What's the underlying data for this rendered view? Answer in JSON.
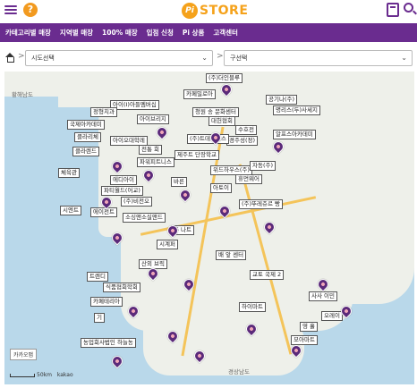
{
  "header": {
    "logo_badge": "Pi",
    "logo_text": "STORE",
    "help_label": "?",
    "icons": [
      "hamburger-icon",
      "help-icon",
      "calculator-icon",
      "search-icon"
    ]
  },
  "nav": {
    "items": [
      "카테고리별 매장",
      "지역별 매장",
      "100% 매장",
      "입점 신청",
      "Pi 상품",
      "고객센터"
    ]
  },
  "filters": {
    "separator": ">",
    "province_select": "시도선택",
    "district_select": "구선택"
  },
  "map": {
    "regions": [
      "황해남도",
      "경상남도"
    ],
    "labels": [
      "(주)더인블루",
      "카페밀로아",
      "아이(I)아들멤버십",
      "공기나(주)",
      "명리스(두)사세지",
      "대헌협회",
      "수호전",
      "경주성(정)",
      "제주트 단장학교",
      "정형치과",
      "국제아카데미",
      "(주)트데이터스",
      "아이브리지",
      "청원 송 문화센터",
      "위드하우스(주)",
      "알프스아카데미",
      "바른",
      "클라리체",
      "농업회사법인 하늘농",
      "(주)뚜레쥬르 빵",
      "산외 브릭",
      "파티월드(어교)",
      "체육관",
      "아토이",
      "클라렌드",
      "아이오대학레",
      "파워피트니스",
      "전통 회",
      "영 흘",
      "사사 이민",
      "배 앞 센터",
      "(주)비전오",
      "에디아이",
      "소싱앤소실앤드",
      "주 나트",
      "시엔트",
      "에이전트",
      "휴먼웨어",
      "자동(주)",
      "시계퍼",
      "오레이",
      "교토 국제 2",
      "하이마트",
      "모아마트",
      "기",
      "카페테리아",
      "트렌디",
      "식품협회학회"
    ],
    "copyright": "카카오맵",
    "scale_text": "50km",
    "map_brand": "kakao"
  },
  "colors": {
    "brand_purple": "#6a2c8f",
    "brand_orange": "#f5a21b",
    "marker": "#5b2a7a"
  }
}
